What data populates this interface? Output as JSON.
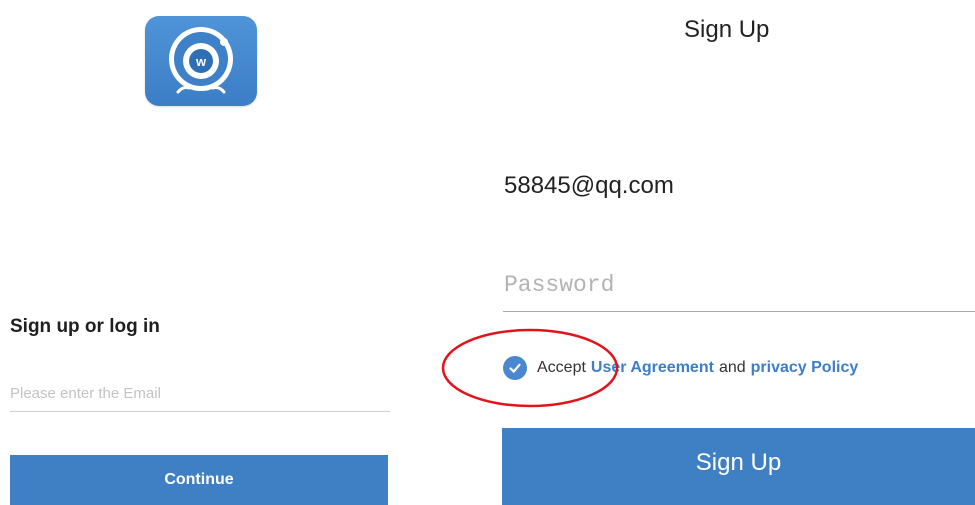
{
  "left_screen": {
    "logo": {
      "icon": "camera-eye-icon",
      "letter": "w",
      "color": "#3f81c9"
    },
    "heading": "Sign up or log in",
    "email_input": {
      "placeholder": "Please enter the Email",
      "value": ""
    },
    "continue_label": "Continue"
  },
  "right_screen": {
    "title": "Sign Up",
    "email_value": "58845@qq.com",
    "password_input": {
      "placeholder": "Password",
      "value": ""
    },
    "agreement": {
      "checked": true,
      "check_icon": "check-circle-icon",
      "accept_text": "Accept",
      "user_agreement_link": "User Agreement",
      "and_text": "and",
      "privacy_link": "privacy Policy"
    },
    "signup_label": "Sign Up"
  },
  "annotation": {
    "shape": "ellipse",
    "color": "#e0141b",
    "target": "agreement-checkbox"
  },
  "colors": {
    "primary": "#3f7fc4",
    "link": "#3c7fc7",
    "text": "#222222"
  }
}
